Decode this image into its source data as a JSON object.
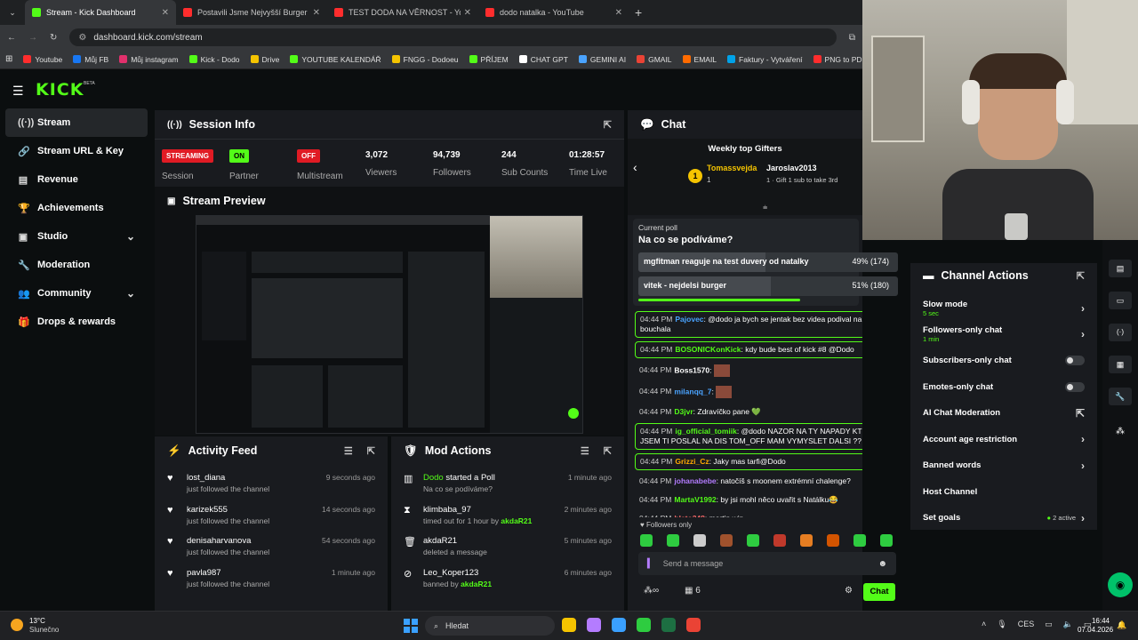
{
  "browser": {
    "tabs": [
      {
        "title": "Stream - Kick Dashboard",
        "color": "#53fc18"
      },
      {
        "title": "Postavili Jsme Nejvyšší Burger na",
        "color": "#ff2d2d"
      },
      {
        "title": "TEST DODA NA VĚRNOST - You",
        "color": "#ff2d2d"
      },
      {
        "title": "dodo natalka - YouTube",
        "color": "#ff2d2d"
      }
    ],
    "url": "dashboard.kick.com/stream",
    "bookmarks": [
      "Youtube",
      "Můj FB",
      "Můj instagram",
      "Kick - Dodo",
      "Drive",
      "YOUTUBE KALENDÁŘ",
      "FNGG - Dodoeu",
      "PŘÍJEM",
      "CHAT GPT",
      "GEMINI AI",
      "GMAIL",
      "EMAIL",
      "Faktury - Vytváření",
      "PNG to PDF"
    ]
  },
  "brand": {
    "logo": "KICK",
    "beta": "BETA",
    "accent": "#53fc18"
  },
  "sidebar": {
    "items": [
      {
        "label": "Stream",
        "icon": "stream-icon",
        "glyph": "((·))",
        "active": true
      },
      {
        "label": "Stream URL & Key",
        "icon": "link-icon",
        "glyph": "🔗"
      },
      {
        "label": "Revenue",
        "icon": "chart-icon",
        "glyph": "▤"
      },
      {
        "label": "Achievements",
        "icon": "trophy-icon",
        "glyph": "🏆"
      },
      {
        "label": "Studio",
        "icon": "studio-icon",
        "glyph": "▣",
        "expand": true
      },
      {
        "label": "Moderation",
        "icon": "wrench-icon",
        "glyph": "🔧"
      },
      {
        "label": "Community",
        "icon": "community-icon",
        "glyph": "👥",
        "expand": true
      },
      {
        "label": "Drops & rewards",
        "icon": "gift-icon",
        "glyph": "🎁"
      }
    ]
  },
  "session": {
    "title": "Session Info",
    "streaming": "STREAMING",
    "session_label": "Session",
    "partner_badge": "ON",
    "partner_label": "Partner",
    "multi_badge": "OFF",
    "multi_label": "Multistream",
    "viewers": "3,072",
    "viewers_label": "Viewers",
    "followers": "94,739",
    "followers_label": "Followers",
    "subs": "244",
    "subs_label": "Sub Counts",
    "time": "01:28:57",
    "time_label": "Time Live"
  },
  "preview": {
    "title": "Stream Preview"
  },
  "activity": {
    "title": "Activity Feed",
    "items": [
      {
        "name": "lost_diana",
        "action": "just followed the channel",
        "time": "9 seconds ago"
      },
      {
        "name": "karizek555",
        "action": "just followed the channel",
        "time": "14 seconds ago"
      },
      {
        "name": "denisaharvanova",
        "action": "just followed the channel",
        "time": "54 seconds ago"
      },
      {
        "name": "pavla987",
        "action": "just followed the channel",
        "time": "1 minute ago"
      }
    ]
  },
  "mod": {
    "title": "Mod Actions",
    "items": [
      {
        "icon": "poll-icon",
        "glyph": "▥",
        "name": "Dodo",
        "rest": " started a Poll",
        "sub": "Na co se podíváme?",
        "time": "1 minute ago"
      },
      {
        "icon": "timeout-icon",
        "glyph": "⧗",
        "name": "klimbaba_97",
        "rest": "",
        "sub": "timed out for 1 hour by ",
        "subby": "akdaR21",
        "time": "2 minutes ago"
      },
      {
        "icon": "trash-icon",
        "glyph": "🗑",
        "name": "akdaR21",
        "rest": "",
        "sub": "deleted a message",
        "time": "5 minutes ago"
      },
      {
        "icon": "ban-icon",
        "glyph": "⊘",
        "name": "Leo_Koper123",
        "rest": "",
        "sub": "banned by ",
        "subby": "akdaR21",
        "time": "6 minutes ago"
      }
    ]
  },
  "chat": {
    "title": "Chat",
    "gifters_title": "Weekly top Gifters",
    "gifter1": "Tomassvejda",
    "gifter1_rank": "1",
    "gifter1_count": "1",
    "gifter2": "Jaroslav2013",
    "gifter2_count": "1",
    "gifter2_note": "Gift 1 sub to take 3rd",
    "poll": {
      "label": "Current poll",
      "question": "Na co se podíváme?",
      "options": [
        {
          "text": "mgfitman reaguje na test duvery od natalky",
          "result": "49% (174)",
          "fraction": 0.49
        },
        {
          "text": "vitek - nejdelsi burger",
          "result": "51% (180)",
          "fraction": 0.51
        }
      ]
    },
    "messages": [
      {
        "time": "04:44 PM",
        "user": "Pajovec",
        "color": "#4aa3ff",
        "text": "@dodo ja bych se jentak bez videa podival na toho bouchala",
        "hl": true
      },
      {
        "time": "04:44 PM",
        "user": "BOSONICKonKick",
        "color": "#53fc18",
        "text": "kdy bude best of kick #8 @Dodo",
        "hl": true
      },
      {
        "time": "04:44 PM",
        "user": "Boss1570",
        "color": "#ffffff",
        "text": "",
        "emote": true
      },
      {
        "time": "04:44 PM",
        "user": "milanqq_7",
        "color": "#4aa3ff",
        "text": "",
        "emote": true
      },
      {
        "time": "04:44 PM",
        "user": "D3jvr",
        "color": "#53fc18",
        "text": "Zdravíčko pane 💚"
      },
      {
        "time": "04:44 PM",
        "user": "ig_official_tomiik",
        "color": "#53fc18",
        "text": "@dodo NAZOR NA TY NAPADY KTERE JSEM TI POSLAL NA DIS TOM_OFF MAM VYMYSLET DALSI ??",
        "hl": true
      },
      {
        "time": "04:44 PM",
        "user": "Grizzi_Cz",
        "color": "#ffaa00",
        "text": "Jaky mas tarfi@Dodo",
        "hl": true
      },
      {
        "time": "04:44 PM",
        "user": "johanabebe",
        "color": "#b47cff",
        "text": "natočíš s moonem extrémní chalenge?"
      },
      {
        "time": "04:44 PM",
        "user": "MartaV1992",
        "color": "#53fc18",
        "text": "by jsi mohl něco uvařit s Natálku😂"
      },
      {
        "time": "04:44 PM",
        "user": "blato348",
        "color": "#ff6b6b",
        "text": "martin win"
      }
    ],
    "followers_only": "Followers only",
    "input_placeholder": "Send a message",
    "count": "6",
    "send": "Chat"
  },
  "channel_actions": {
    "title": "Channel Actions",
    "items": [
      {
        "label": "Slow mode",
        "sub": "5 sec",
        "ctrl": "chevron"
      },
      {
        "label": "Followers-only chat",
        "sub": "1 min",
        "ctrl": "chevron"
      },
      {
        "label": "Subscribers-only chat",
        "ctrl": "toggle"
      },
      {
        "label": "Emotes-only chat",
        "ctrl": "toggle"
      },
      {
        "label": "AI Chat Moderation",
        "ctrl": "link"
      },
      {
        "label": "Account age restriction",
        "ctrl": "chevron"
      },
      {
        "label": "Banned words",
        "ctrl": "chevron"
      },
      {
        "label": "Host Channel",
        "ctrl": "none"
      },
      {
        "label": "Set goals",
        "ctrl": "goals",
        "extra": "2 active"
      }
    ]
  },
  "taskbar": {
    "weather_temp": "13°C",
    "weather_desc": "Slunečno",
    "search": "Hledat",
    "lang": "CES",
    "time": "16:44",
    "date": "07.04.2026"
  }
}
